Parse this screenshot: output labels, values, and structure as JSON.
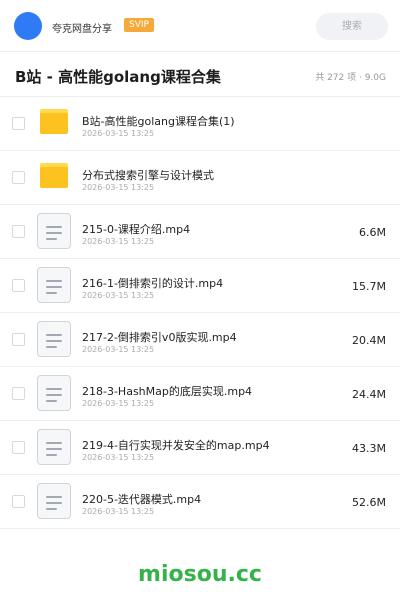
{
  "header": {
    "user_name": "夸克网盘分享",
    "badge": "SVIP",
    "search_label": "搜索"
  },
  "folder": {
    "title": "B站 - 高性能golang课程合集",
    "summary": "共 272 项 · 9.0G"
  },
  "items": [
    {
      "type": "folder",
      "name": "B站-高性能golang课程合集(1)",
      "date": "2026-03-15 13:25",
      "size": ""
    },
    {
      "type": "folder",
      "name": "分布式搜索引擎与设计模式",
      "date": "2026-03-15 13:25",
      "size": ""
    },
    {
      "type": "file",
      "name": "215-0-课程介绍.mp4",
      "date": "2026-03-15 13:25",
      "size": "6.6M"
    },
    {
      "type": "file",
      "name": "216-1-倒排索引的设计.mp4",
      "date": "2026-03-15 13:25",
      "size": "15.7M"
    },
    {
      "type": "file",
      "name": "217-2-倒排索引v0版实现.mp4",
      "date": "2026-03-15 13:25",
      "size": "20.4M"
    },
    {
      "type": "file",
      "name": "218-3-HashMap的底层实现.mp4",
      "date": "2026-03-15 13:25",
      "size": "24.4M"
    },
    {
      "type": "file",
      "name": "219-4-自行实现并发安全的map.mp4",
      "date": "2026-03-15 13:25",
      "size": "43.3M"
    },
    {
      "type": "file",
      "name": "220-5-迭代器模式.mp4",
      "date": "2026-03-15 13:25",
      "size": "52.6M"
    }
  ],
  "watermark": "miosou.cc",
  "colors": {
    "avatar": "#2f7bf5",
    "badge": "#f4a93a",
    "folder": "#fcc320",
    "watermark": "#35b34a"
  }
}
